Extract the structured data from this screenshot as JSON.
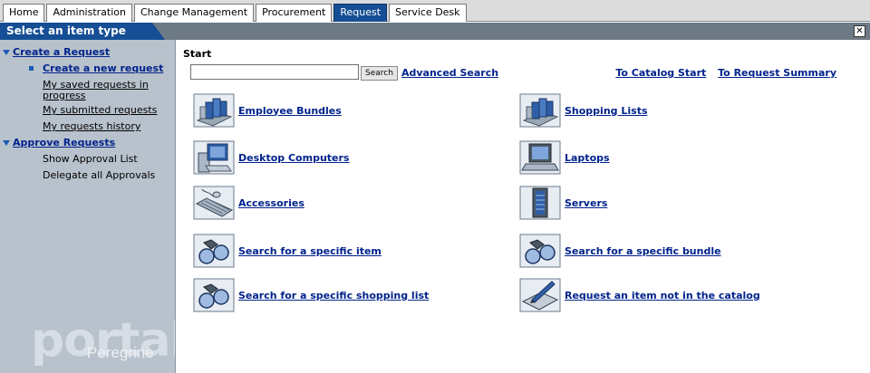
{
  "tabs": [
    "Home",
    "Administration",
    "Change Management",
    "Procurement",
    "Request",
    "Service Desk"
  ],
  "active_tab": "Request",
  "header": {
    "title": "Select an item type",
    "close_glyph": "✕"
  },
  "sidebar": {
    "create_request": "Create a Request",
    "create_new_request": "Create a new request",
    "saved_requests": "My saved requests in progress",
    "submitted_requests": "My submitted requests",
    "requests_history": "My requests history",
    "approve_requests": "Approve Requests",
    "show_approval_list": "Show Approval List",
    "delegate_approvals": "Delegate all Approvals",
    "watermark_portal": "portal",
    "watermark_peregrine": "Peregrine"
  },
  "main": {
    "start_title": "Start",
    "search_value": "",
    "search_button": "Search",
    "advanced_search": "Advanced Search",
    "to_catalog_start": "To Catalog Start",
    "to_request_summary": "To Request Summary",
    "items": [
      {
        "label": "Employee Bundles",
        "icon": "employee-bundles-icon"
      },
      {
        "label": "Shopping Lists",
        "icon": "shopping-lists-icon"
      },
      {
        "label": "Desktop Computers",
        "icon": "desktop-computer-icon"
      },
      {
        "label": "Laptops",
        "icon": "laptop-icon"
      },
      {
        "label": "Accessories",
        "icon": "keyboard-mouse-icon"
      },
      {
        "label": "Servers",
        "icon": "server-icon"
      },
      {
        "label": "Search for a specific item",
        "icon": "binoculars-icon"
      },
      {
        "label": "Search for a specific bundle",
        "icon": "binoculars-icon"
      },
      {
        "label": "Search for a specific shopping list",
        "icon": "binoculars-icon"
      },
      {
        "label": "Request an item not in the catalog",
        "icon": "pen-paper-icon"
      }
    ]
  },
  "colors": {
    "accent": "#154e94",
    "link": "#00238c",
    "sidebar_bg": "#b8c2cc",
    "header_band": "#6d7a86"
  }
}
